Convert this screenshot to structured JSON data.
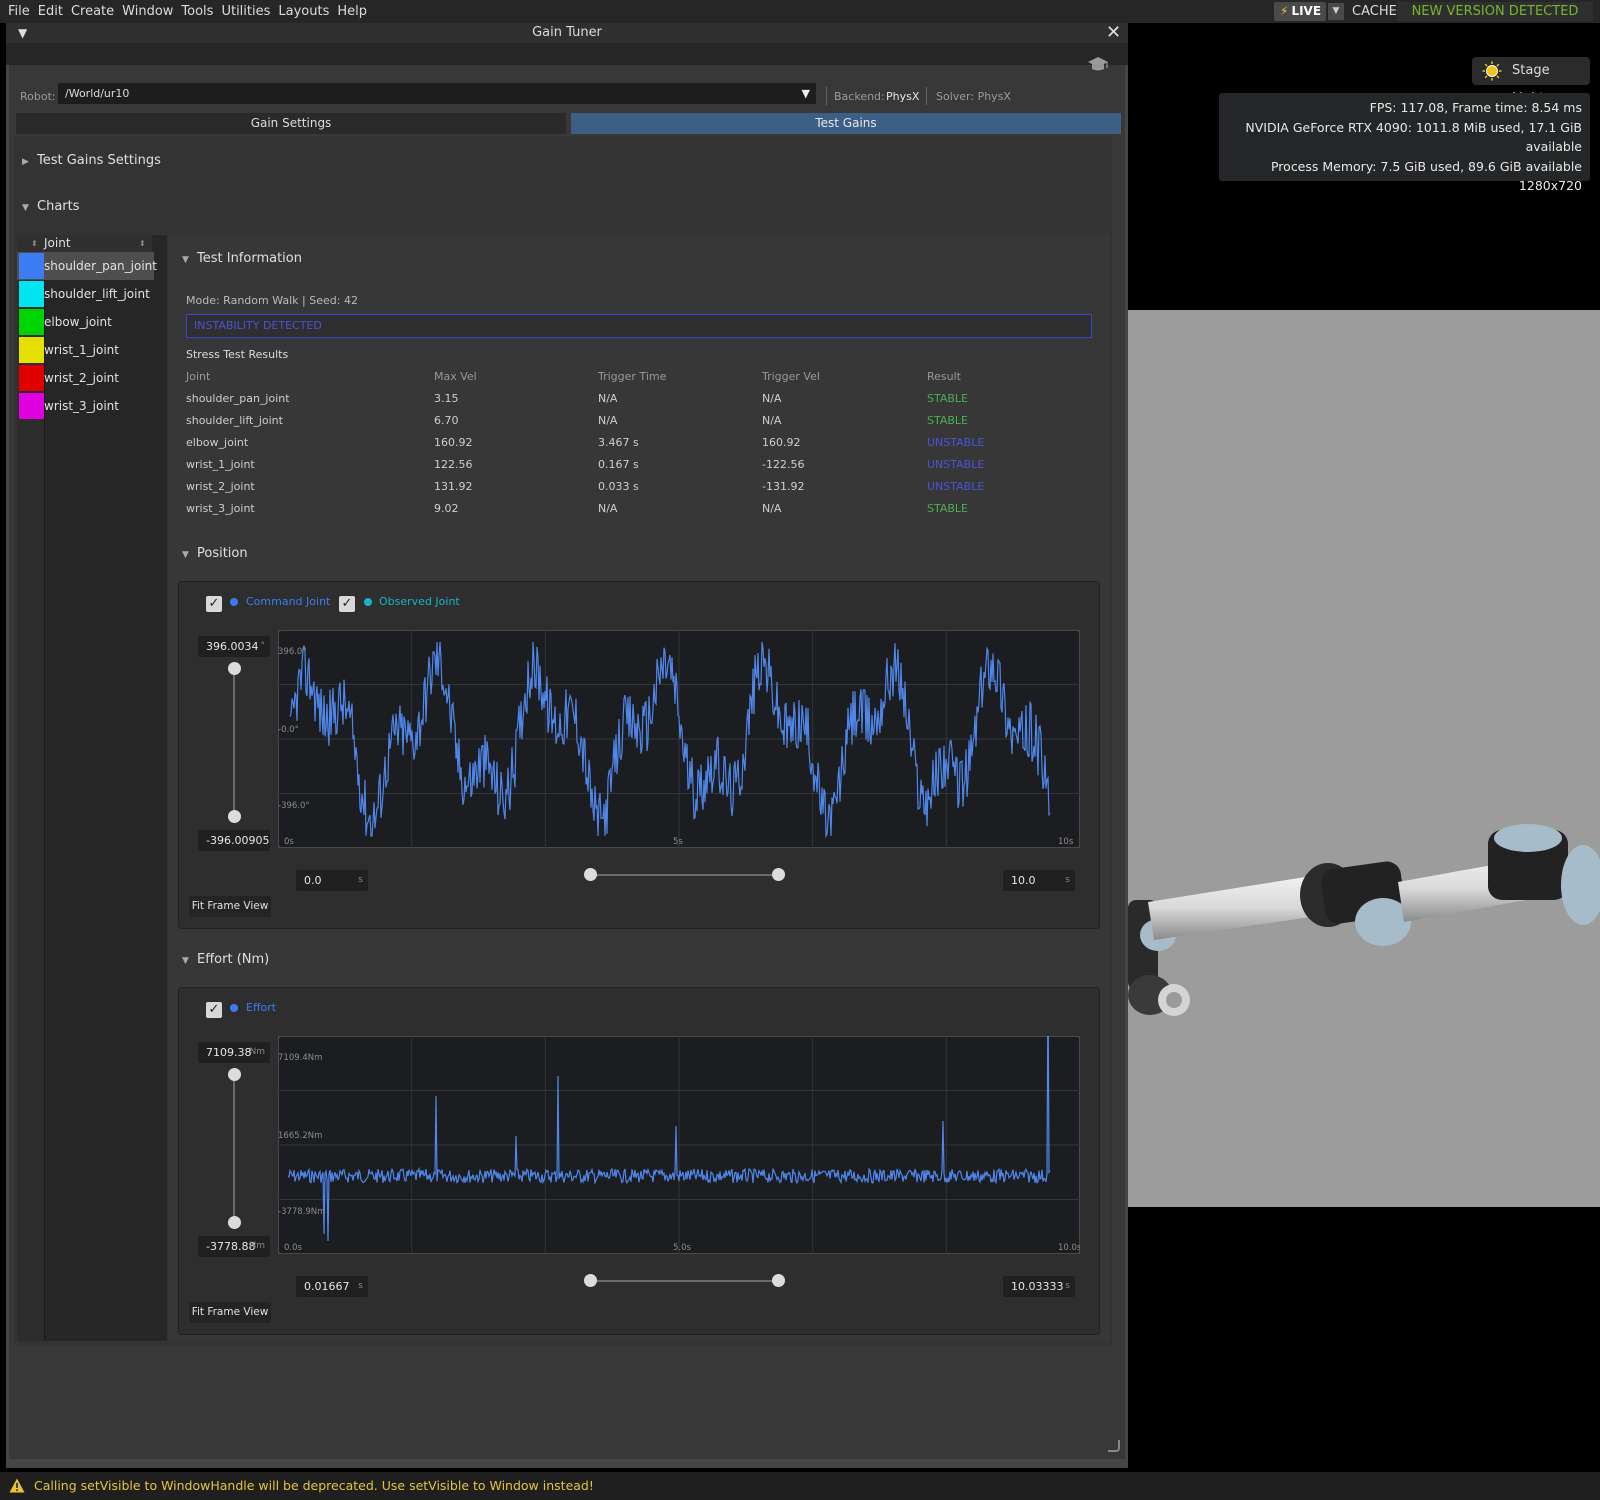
{
  "menubar": {
    "items": [
      "File",
      "Edit",
      "Create",
      "Window",
      "Tools",
      "Utilities",
      "Layouts",
      "Help"
    ],
    "live_label": "LIVE",
    "cache_label": "CACHE:",
    "cache_status": "NEW VERSION DETECTED"
  },
  "viewport": {
    "stage_lights_label": "Stage Lights",
    "stats": [
      "FPS: 117.08, Frame time: 8.54 ms",
      "NVIDIA GeForce RTX 4090: 1011.8 MiB used, 17.1 GiB available",
      "Process Memory: 7.5 GiB used, 89.6 GiB available",
      "1280x720"
    ]
  },
  "window": {
    "title": "Gain Tuner",
    "robot_label": "Robot:",
    "robot_value": "/World/ur10",
    "backend_label": "Backend:",
    "backend_value": "PhysX",
    "solver_text": "Solver: PhysX",
    "tabs": [
      {
        "label": "Gain Settings",
        "active": false
      },
      {
        "label": "Test Gains",
        "active": true
      }
    ],
    "sections": {
      "test_gains_settings": "Test Gains Settings",
      "charts": "Charts",
      "test_information": "Test Information",
      "position": "Position",
      "effort": "Effort (Nm)"
    }
  },
  "joint_list": {
    "header": "Joint",
    "items": [
      {
        "name": "shoulder_pan_joint",
        "color": "#3b7cf5"
      },
      {
        "name": "shoulder_lift_joint",
        "color": "#00e5f0"
      },
      {
        "name": "elbow_joint",
        "color": "#00d400"
      },
      {
        "name": "wrist_1_joint",
        "color": "#e5e000"
      },
      {
        "name": "wrist_2_joint",
        "color": "#e00000"
      },
      {
        "name": "wrist_3_joint",
        "color": "#e000e0"
      }
    ]
  },
  "test_info": {
    "mode": "Mode: Random Walk | Seed: 42",
    "instability": "INSTABILITY DETECTED",
    "stress_title": "Stress Test Results",
    "columns": [
      "Joint",
      "Max Vel",
      "Trigger Time",
      "Trigger Vel",
      "Result"
    ],
    "rows": [
      [
        "shoulder_pan_joint",
        "3.15",
        "N/A",
        "N/A",
        "STABLE"
      ],
      [
        "shoulder_lift_joint",
        "6.70",
        "N/A",
        "N/A",
        "STABLE"
      ],
      [
        "elbow_joint",
        "160.92",
        "3.467 s",
        "160.92",
        "UNSTABLE"
      ],
      [
        "wrist_1_joint",
        "122.56",
        "0.167 s",
        "-122.56",
        "UNSTABLE"
      ],
      [
        "wrist_2_joint",
        "131.92",
        "0.033 s",
        "-131.92",
        "UNSTABLE"
      ],
      [
        "wrist_3_joint",
        "9.02",
        "N/A",
        "N/A",
        "STABLE"
      ]
    ]
  },
  "position_chart": {
    "legend": [
      {
        "label": "Command Joint",
        "color": "#3b7cf5",
        "checked": true
      },
      {
        "label": "Observed Joint",
        "color": "#19b3c9",
        "checked": true
      }
    ],
    "y_max_field": "396.0034",
    "y_max_unit": "°",
    "y_min_field": "-396.00905",
    "y_min_unit": "°",
    "y_ticks": [
      "396.0°",
      "-0.0°",
      "-396.0°"
    ],
    "x_ticks": [
      "0s",
      "5s",
      "10s"
    ],
    "x_start_field": "0.0",
    "x_end_field": "10.0",
    "x_unit": "s",
    "fit_button": "Fit Frame View"
  },
  "effort_chart": {
    "legend": [
      {
        "label": "Effort",
        "color": "#3b7cf5",
        "checked": true
      }
    ],
    "y_max_field": "7109.38",
    "y_min_field": "-3778.88",
    "y_unit": "Nm",
    "y_ticks": [
      "7109.4Nm",
      "1665.2Nm",
      "-3778.9Nm"
    ],
    "x_ticks": [
      "0.0s",
      "5.0s",
      "10.0s"
    ],
    "x_start_field": "0.01667",
    "x_end_field": "10.03333",
    "x_unit": "s",
    "fit_button": "Fit Frame View"
  },
  "warning": "Calling setVisible to WindowHandle will be deprecated. Use setVisible to Window instead!"
}
